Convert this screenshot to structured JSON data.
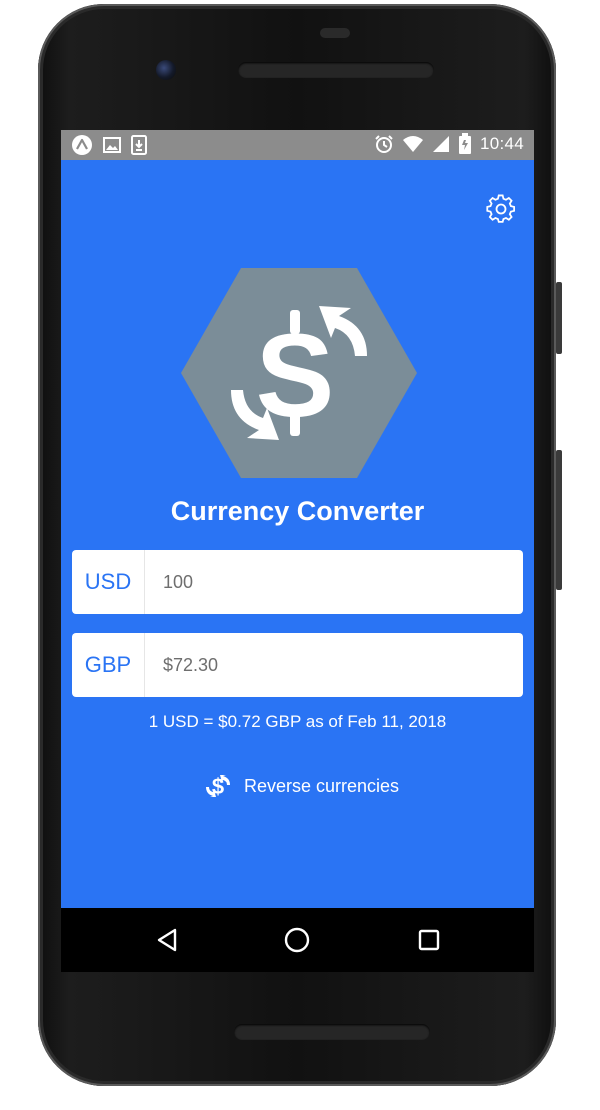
{
  "status_bar": {
    "time": "10:44",
    "left_icons": [
      "android-auto-icon",
      "image-icon",
      "download-icon"
    ],
    "right_icons": [
      "alarm-icon",
      "wifi-icon",
      "signal-icon",
      "battery-icon"
    ]
  },
  "app": {
    "title": "Currency Converter",
    "settings_icon": "gear-icon",
    "logo_icon": "currency-exchange-logo"
  },
  "base": {
    "code": "USD",
    "value": "100"
  },
  "quote": {
    "code": "GBP",
    "value": "$72.30"
  },
  "rate_text": "1 USD = $0.72 GBP as of Feb 11, 2018",
  "reverse": {
    "label": "Reverse currencies",
    "icon": "reverse-currency-icon"
  },
  "navigation": {
    "back_icon": "back-triangle-icon",
    "home_icon": "home-circle-icon",
    "recents_icon": "recents-square-icon"
  },
  "colors": {
    "background": "#2a74f4",
    "logo_hex": "#7b8d98",
    "text_on_primary": "#ffffff"
  }
}
